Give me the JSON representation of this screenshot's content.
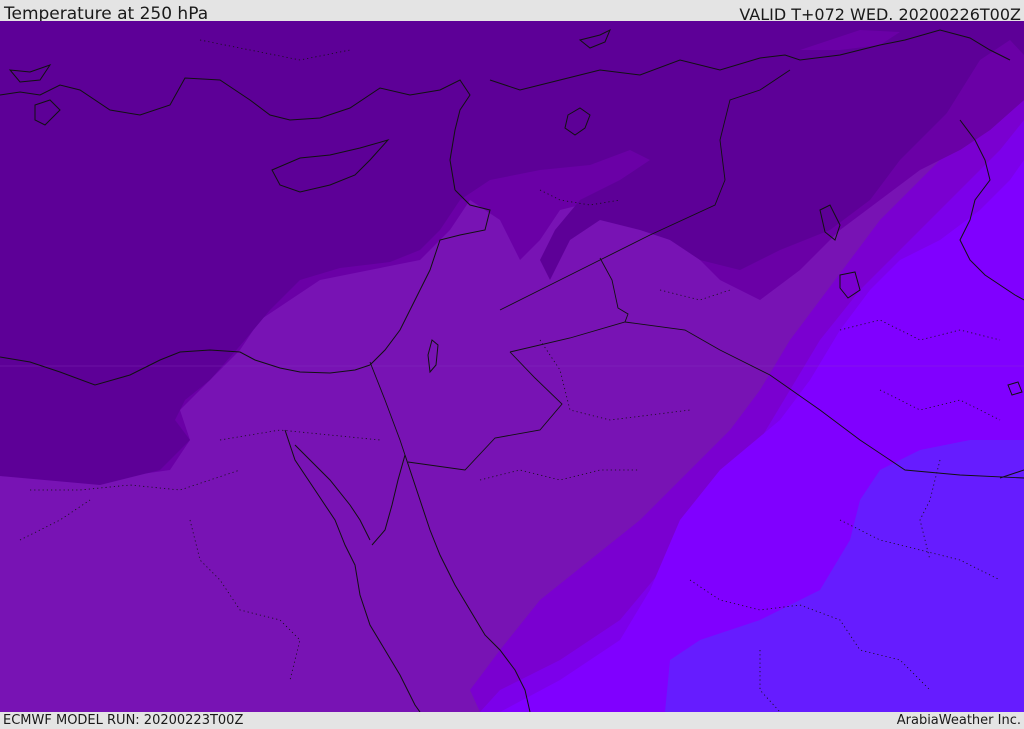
{
  "header": {
    "title": "Temperature at 250 hPa",
    "valid": "VALID T+072 WED. 20200226T00Z"
  },
  "footer": {
    "model_run": "ECMWF MODEL RUN: 20200223T00Z",
    "credit": "ArabiaWeather Inc."
  },
  "map": {
    "field": "temperature",
    "level": "250 hPa",
    "colors": {
      "band_coldest": "#5d0097",
      "band_2": "#6a00a6",
      "band_3": "#7813b4",
      "band_4": "#7a00d0",
      "band_5": "#7c00ea",
      "band_6": "#8000ff",
      "band_warmest": "#661cff",
      "coastline": "#111111",
      "border": "#111111"
    }
  }
}
